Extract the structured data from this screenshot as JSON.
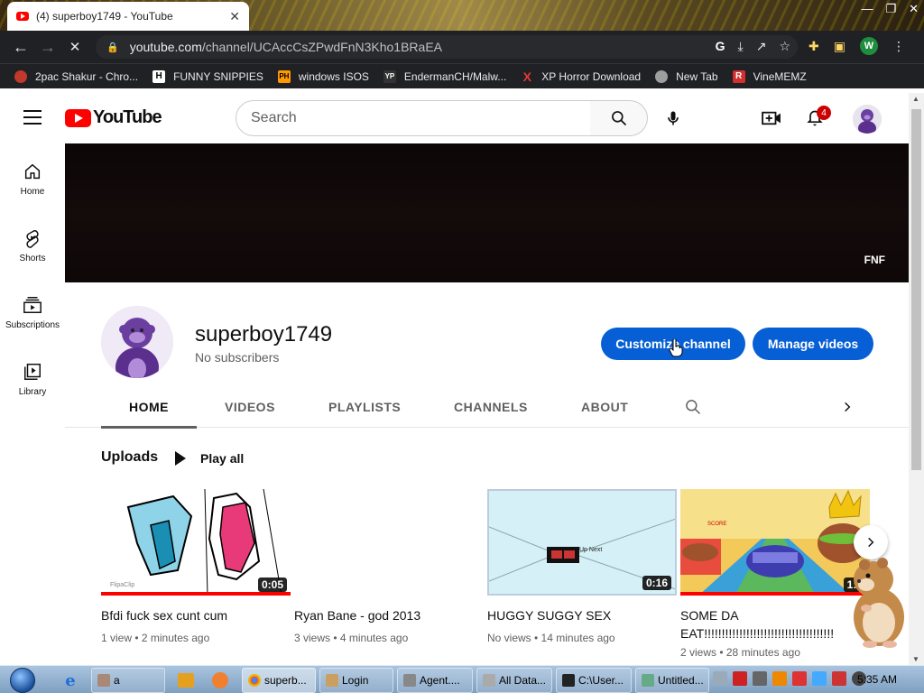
{
  "browser": {
    "tab_title": "(4) superboy1749 - YouTube",
    "url_host": "youtube.com",
    "url_path": "/channel/UCAccCsZPwdFnN3Kho1BRaEA",
    "profile_initial": "W",
    "bookmarks": [
      {
        "label": "2pac Shakur - Chro...",
        "icon": "cookie-icon"
      },
      {
        "label": "FUNNY SNIPPIES",
        "icon": "H"
      },
      {
        "label": "windows ISOS",
        "icon": "PH"
      },
      {
        "label": "EndermanCH/Malw...",
        "icon": "YP"
      },
      {
        "label": "XP Horror Download",
        "icon": "X"
      },
      {
        "label": "New Tab",
        "icon": "globe-icon"
      },
      {
        "label": "VineMEMZ",
        "icon": "R"
      }
    ]
  },
  "youtube": {
    "logo_text": "YouTube",
    "search_placeholder": "Search",
    "notification_count": "4",
    "guide": [
      {
        "label": "Home",
        "icon": "home-icon"
      },
      {
        "label": "Shorts",
        "icon": "shorts-icon"
      },
      {
        "label": "Subscriptions",
        "icon": "subscriptions-icon"
      },
      {
        "label": "Library",
        "icon": "library-icon"
      }
    ],
    "banner_text": "FNF",
    "channel": {
      "name": "superboy1749",
      "subscribers": "No subscribers",
      "customize_label": "Customize channel",
      "manage_label": "Manage videos"
    },
    "tabs": [
      "HOME",
      "VIDEOS",
      "PLAYLISTS",
      "CHANNELS",
      "ABOUT"
    ],
    "uploads_label": "Uploads",
    "play_all_label": "Play all",
    "videos": [
      {
        "title": "Bfdi fuck sex cunt cum",
        "meta": "1 view • 2 minutes ago",
        "duration": "0:05"
      },
      {
        "title": "Ryan Bane - god 2013",
        "meta": "3 views • 4 minutes ago",
        "duration": ""
      },
      {
        "title": "HUGGY SUGGY SEX",
        "meta": "No views • 14 minutes ago",
        "duration": "0:16",
        "thumb_text": "Up Next"
      },
      {
        "title": "SOME DA EAT!!!!!!!!!!!!!!!!!!!!!!!!!!!!!!!!!!!!!",
        "meta": "2 views • 28 minutes ago",
        "duration": "1:0"
      }
    ]
  },
  "taskbar": {
    "buttons": [
      "a",
      "superb...",
      "Login",
      "Agent....",
      "All Data...",
      "C:\\User...",
      "Untitled..."
    ],
    "clock": "5:35 AM"
  },
  "colors": {
    "brand_red": "#ff0000",
    "button_blue": "#065fd4"
  }
}
